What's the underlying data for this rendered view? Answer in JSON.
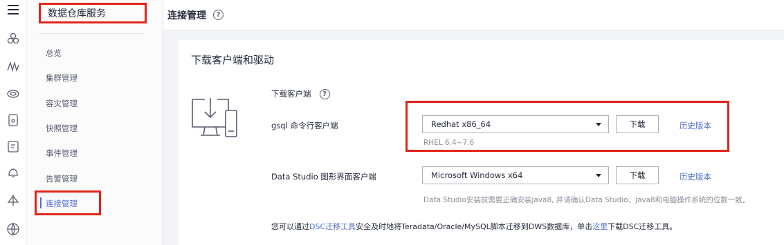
{
  "rail": {
    "icons": [
      "menu-icon",
      "overview-icon",
      "cluster-icon",
      "disaster-icon",
      "snapshot-icon",
      "event-icon",
      "alarm-icon",
      "connection-icon",
      "globe-icon"
    ]
  },
  "sidebar": {
    "title": "数据仓库服务",
    "items": [
      {
        "label": "总览"
      },
      {
        "label": "集群管理"
      },
      {
        "label": "容灾管理"
      },
      {
        "label": "快照管理"
      },
      {
        "label": "事件管理"
      },
      {
        "label": "告警管理"
      },
      {
        "label": "连接管理"
      }
    ],
    "active_index": 6
  },
  "header": {
    "title": "连接管理",
    "help": "?"
  },
  "card": {
    "title": "下载客户端和驱动",
    "section_label": "下载客户端",
    "section_help": "?",
    "gsql": {
      "label": "gsql 命令行客户端",
      "selected": "Redhat x86_64",
      "hint": "RHEL 6.4~7.6",
      "download": "下载",
      "history": "历史版本"
    },
    "studio": {
      "label": "Data Studio 图形界面客户端",
      "selected": "Microsoft Windows x64",
      "hint": "Data Studio安装前需要正确安装java8, 并请确认Data Studio、java8和电脑操作系统的位数一致。",
      "download": "下载",
      "history": "历史版本"
    },
    "footer": {
      "prefix": "您可以通过",
      "link1": "DSC迁移工具",
      "middle": "安全及时地将Teradata/Oracle/MySQL脚本迁移到DWS数据库，单击",
      "link2": "这里",
      "suffix": "下载DSC迁移工具。"
    }
  }
}
